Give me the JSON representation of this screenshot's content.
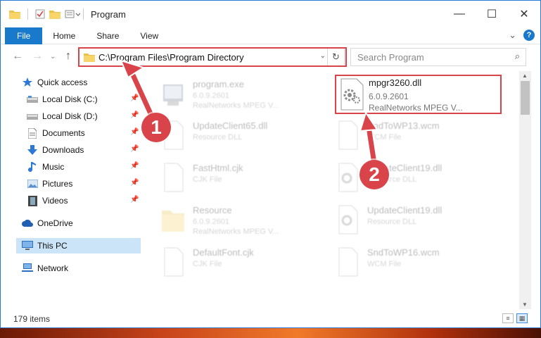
{
  "window": {
    "title": "Program",
    "controls": {
      "minimize": "—",
      "maximize": "☐",
      "close": "✕"
    }
  },
  "ribbon": {
    "tabs": [
      {
        "label": "File"
      },
      {
        "label": "Home"
      },
      {
        "label": "Share"
      },
      {
        "label": "View"
      }
    ],
    "expand_glyph": "⌄",
    "help_glyph": "?"
  },
  "nav": {
    "back_glyph": "←",
    "forward_glyph": "→",
    "recent_glyph": "⌄",
    "up_glyph": "↑",
    "address": "C:\\Program Files\\Program Directory",
    "dropdown_glyph": "⌄",
    "refresh_glyph": "↻",
    "search_placeholder": "Search Program",
    "search_glyph": "⌕"
  },
  "sidebar": {
    "items": [
      {
        "label": "Quick access",
        "icon": "star-icon",
        "pinned": false
      },
      {
        "label": "Local Disk (C:)",
        "icon": "drive-icon",
        "pinned": true
      },
      {
        "label": "Local Disk (D:)",
        "icon": "drive-icon",
        "pinned": true
      },
      {
        "label": "Documents",
        "icon": "document-icon",
        "pinned": true
      },
      {
        "label": "Downloads",
        "icon": "download-icon",
        "pinned": true
      },
      {
        "label": "Music",
        "icon": "music-icon",
        "pinned": true
      },
      {
        "label": "Pictures",
        "icon": "pictures-icon",
        "pinned": true
      },
      {
        "label": "Videos",
        "icon": "video-icon",
        "pinned": true
      },
      {
        "label": "OneDrive",
        "icon": "cloud-icon",
        "pinned": false
      },
      {
        "label": "This PC",
        "icon": "computer-icon",
        "pinned": false,
        "selected": true
      },
      {
        "label": "Network",
        "icon": "network-icon",
        "pinned": false
      }
    ],
    "pin_glyph": "📌"
  },
  "files": [
    {
      "name": "program.exe",
      "line1": "6.0.9.2601",
      "line2": "RealNetworks MPEG V...",
      "icon": "exe-icon"
    },
    {
      "name": "mpgr3260.dll",
      "line1": "6.0.9.2601",
      "line2": "RealNetworks MPEG V...",
      "icon": "dll-icon",
      "highlighted": true
    },
    {
      "name": "UpdateClient65.dll",
      "line1": "Resource DLL",
      "line2": "",
      "icon": "blank-file-icon"
    },
    {
      "name": "SndToWP13.wcm",
      "line1": "WCM File",
      "line2": "",
      "icon": "blank-file-icon"
    },
    {
      "name": "FastHtml.cjk",
      "line1": "CJK File",
      "line2": "",
      "icon": "blank-file-icon"
    },
    {
      "name": "UpdateClient19.dll",
      "line1": "Resource DLL",
      "line2": "",
      "icon": "dll-icon"
    },
    {
      "name": "Resource",
      "line1": "6.0.9.2601",
      "line2": "RealNetworks MPEG V...",
      "icon": "folder-icon"
    },
    {
      "name": "UpdateClient19.dll",
      "line1": "Resource DLL",
      "line2": "",
      "icon": "dll-icon"
    },
    {
      "name": "DefaultFont.cjk",
      "line1": "CJK File",
      "line2": "",
      "icon": "blank-file-icon"
    },
    {
      "name": "SndToWP16.wcm",
      "line1": "WCM File",
      "line2": "",
      "icon": "blank-file-icon"
    }
  ],
  "status": {
    "item_count": "179 items"
  },
  "callouts": [
    {
      "number": "1"
    },
    {
      "number": "2"
    }
  ],
  "colors": {
    "accent": "#1979ca",
    "callout": "#d9434a",
    "selection": "#cce4f7"
  }
}
